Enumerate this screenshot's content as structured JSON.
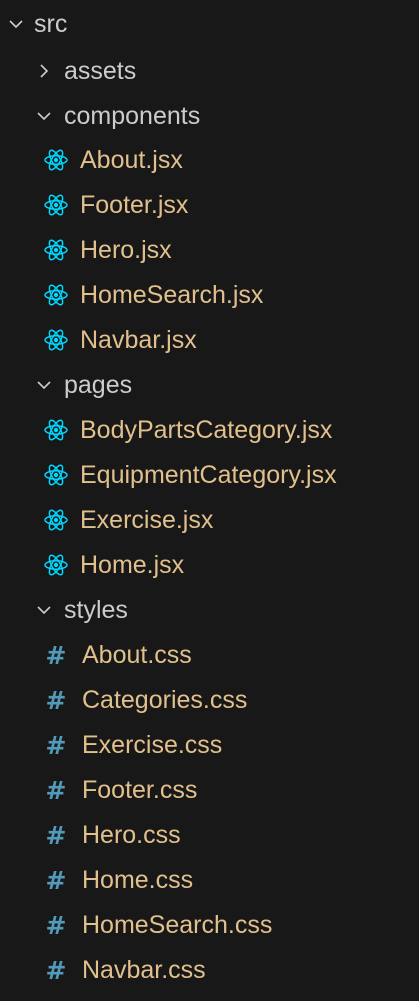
{
  "explorer": {
    "root": {
      "label": "src",
      "expanded": true
    },
    "folders": [
      {
        "label": "assets",
        "expanded": false,
        "files": []
      },
      {
        "label": "components",
        "expanded": true,
        "files": [
          {
            "label": "About.jsx",
            "icon": "react-icon"
          },
          {
            "label": "Footer.jsx",
            "icon": "react-icon"
          },
          {
            "label": "Hero.jsx",
            "icon": "react-icon"
          },
          {
            "label": "HomeSearch.jsx",
            "icon": "react-icon"
          },
          {
            "label": "Navbar.jsx",
            "icon": "react-icon"
          }
        ]
      },
      {
        "label": "pages",
        "expanded": true,
        "files": [
          {
            "label": "BodyPartsCategory.jsx",
            "icon": "react-icon"
          },
          {
            "label": "EquipmentCategory.jsx",
            "icon": "react-icon"
          },
          {
            "label": "Exercise.jsx",
            "icon": "react-icon"
          },
          {
            "label": "Home.jsx",
            "icon": "react-icon"
          }
        ]
      },
      {
        "label": "styles",
        "expanded": true,
        "files": [
          {
            "label": "About.css",
            "icon": "hash-icon",
            "glyph": "#"
          },
          {
            "label": "Categories.css",
            "icon": "hash-icon",
            "glyph": "#"
          },
          {
            "label": "Exercise.css",
            "icon": "hash-icon",
            "glyph": "#"
          },
          {
            "label": "Footer.css",
            "icon": "hash-icon",
            "glyph": "#"
          },
          {
            "label": "Hero.css",
            "icon": "hash-icon",
            "glyph": "#"
          },
          {
            "label": "Home.css",
            "icon": "hash-icon",
            "glyph": "#"
          },
          {
            "label": "HomeSearch.css",
            "icon": "hash-icon",
            "glyph": "#"
          },
          {
            "label": "Navbar.css",
            "icon": "hash-icon",
            "glyph": "#"
          }
        ]
      }
    ]
  },
  "colors": {
    "background": "#181818",
    "folder_text": "#cccccc",
    "modified_file_text": "#e2c08d",
    "react_icon": "#00d8ff",
    "css_icon": "#519aba",
    "chevron": "#cccccc"
  }
}
